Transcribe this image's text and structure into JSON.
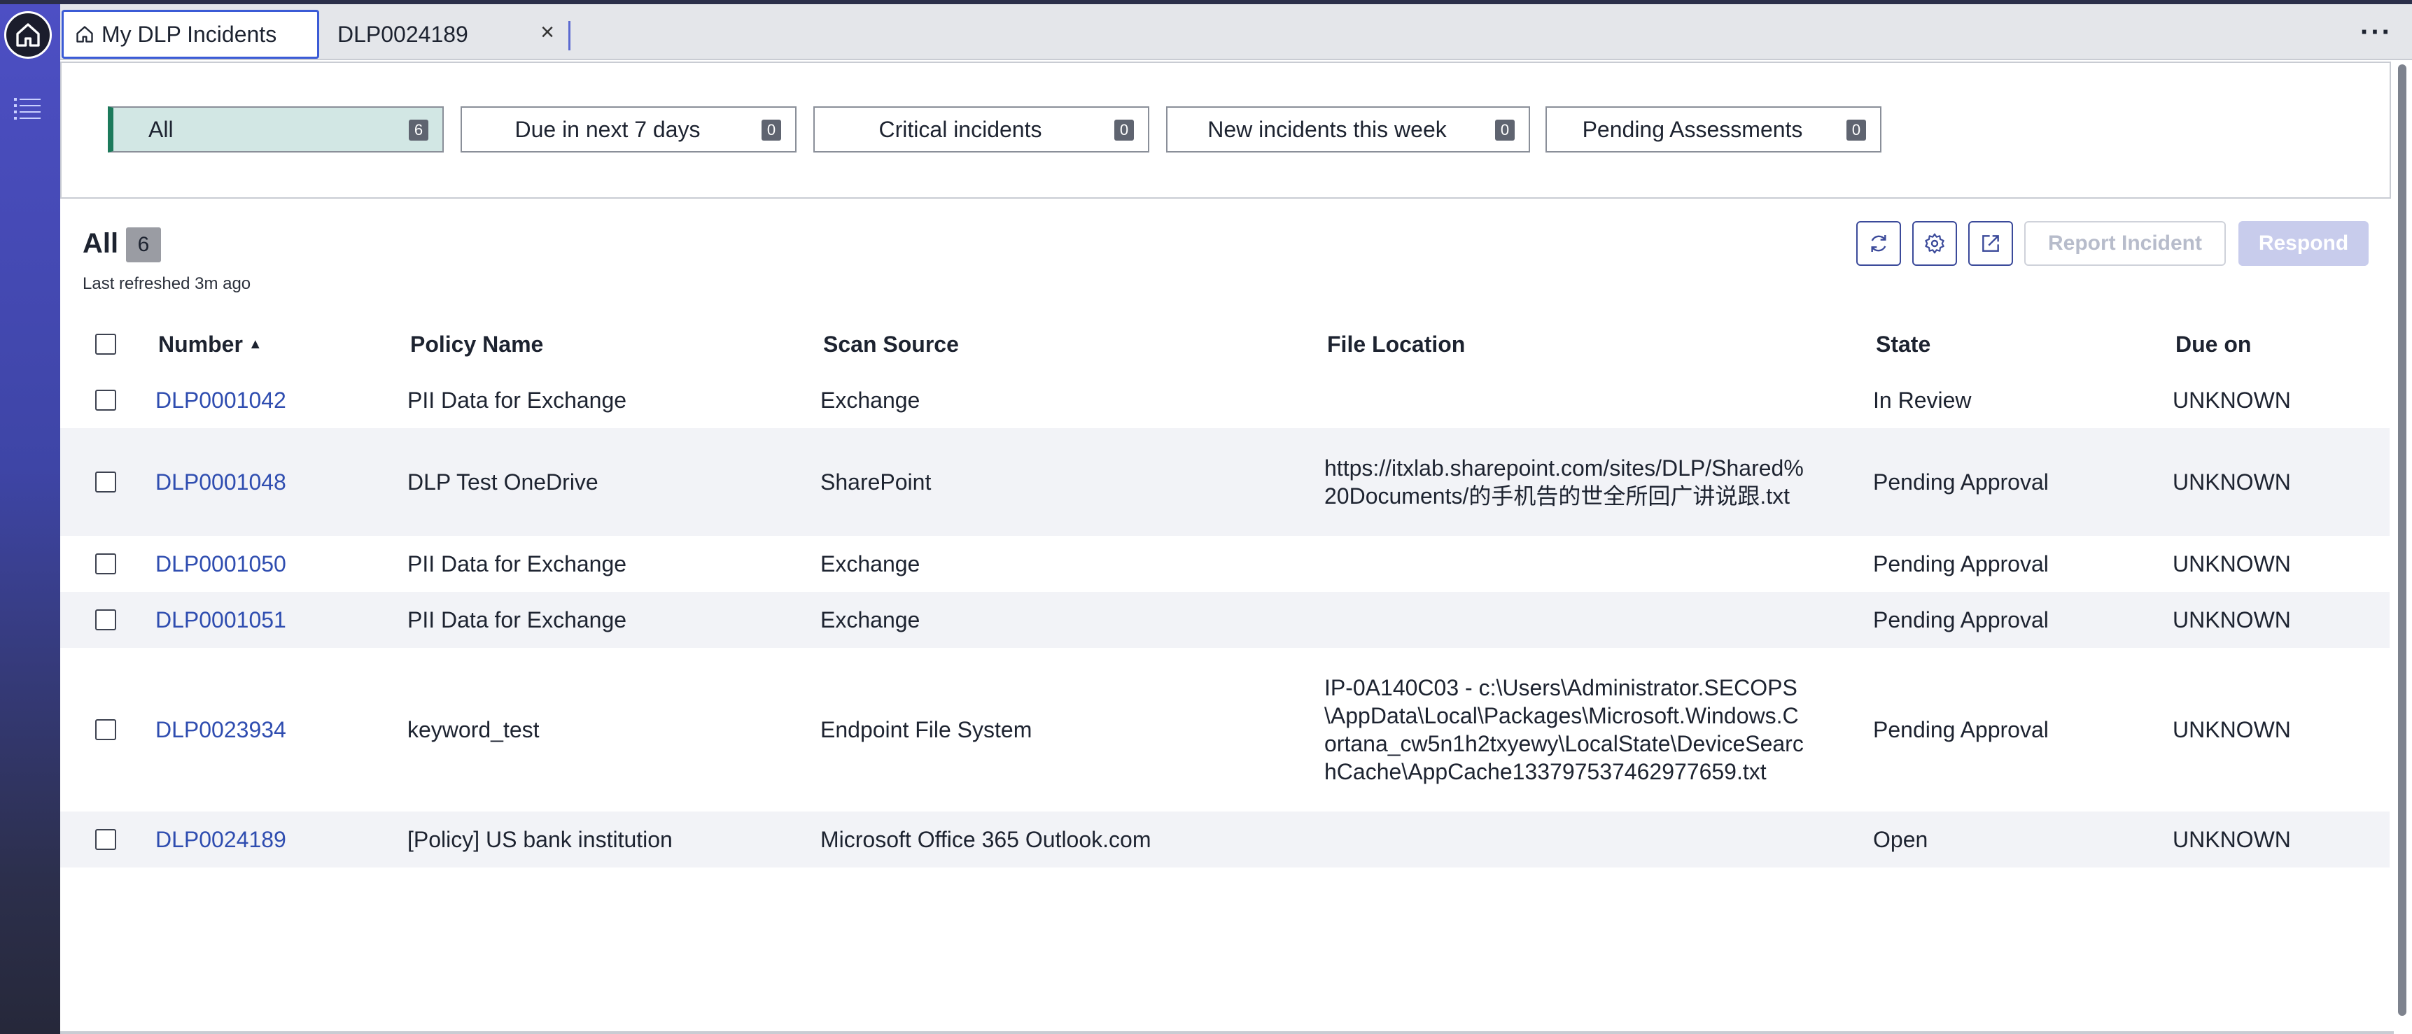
{
  "tabs": [
    {
      "label": "My DLP Incidents",
      "active": true
    },
    {
      "label": "DLP0024189",
      "active": false
    }
  ],
  "tab_close_symbol": "×",
  "more_symbol": "···",
  "filters": [
    {
      "label": "All",
      "count": "6"
    },
    {
      "label": "Due in next 7 days",
      "count": "0"
    },
    {
      "label": "Critical incidents",
      "count": "0"
    },
    {
      "label": "New incidents this week",
      "count": "0"
    },
    {
      "label": "Pending Assessments",
      "count": "0"
    }
  ],
  "list": {
    "title": "All",
    "count": "6",
    "last_refreshed": "Last refreshed 3m ago"
  },
  "actions": {
    "refresh_icon": "refresh-icon",
    "settings_icon": "gear-icon",
    "export_icon": "export-icon",
    "report_label": "Report Incident",
    "respond_label": "Respond"
  },
  "table": {
    "columns": [
      "Number",
      "Policy Name",
      "Scan Source",
      "File Location",
      "State",
      "Due on"
    ],
    "sort_indicator": "▲",
    "rows": [
      {
        "number": "DLP0001042",
        "policy": "PII Data for Exchange",
        "source": "Exchange",
        "location": "",
        "state": "In Review",
        "due": "UNKNOWN"
      },
      {
        "number": "DLP0001048",
        "policy": "DLP Test OneDrive",
        "source": "SharePoint",
        "location": "https://itxlab.sharepoint.com/sites/DLP/Shared%20Documents/的手机告的世全所回广讲说跟.txt",
        "state": "Pending Approval",
        "due": "UNKNOWN"
      },
      {
        "number": "DLP0001050",
        "policy": "PII Data for Exchange",
        "source": "Exchange",
        "location": "",
        "state": "Pending Approval",
        "due": "UNKNOWN"
      },
      {
        "number": "DLP0001051",
        "policy": "PII Data for Exchange",
        "source": "Exchange",
        "location": "",
        "state": "Pending Approval",
        "due": "UNKNOWN"
      },
      {
        "number": "DLP0023934",
        "policy": "keyword_test",
        "source": "Endpoint File System",
        "location": "IP-0A140C03 - c:\\Users\\Administrator.SECOPS\\AppData\\Local\\Packages\\Microsoft.Windows.Cortana_cw5n1h2txyewy\\LocalState\\DeviceSearchCache\\AppCache133797537462977659.txt",
        "state": "Pending Approval",
        "due": "UNKNOWN"
      },
      {
        "number": "DLP0024189",
        "policy": "[Policy] US bank institution",
        "source": "Microsoft Office 365 Outlook.com",
        "location": "",
        "state": "Open",
        "due": "UNKNOWN"
      }
    ]
  },
  "colors": {
    "accent": "#3b5bd6",
    "link": "#2f4db0",
    "filter_active_bg": "#d2e7e4",
    "filter_active_bar": "#1c7a5b"
  }
}
